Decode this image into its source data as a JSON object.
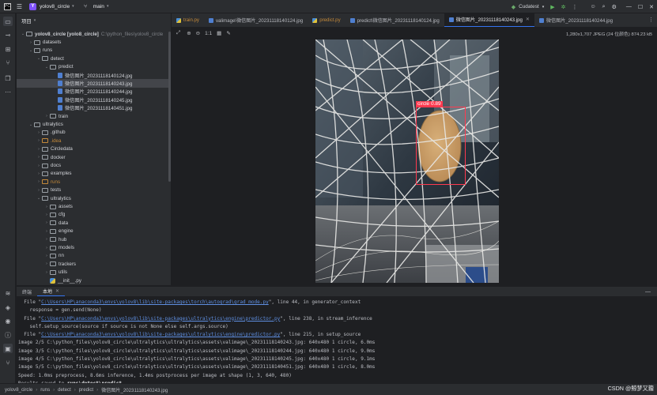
{
  "titlebar": {
    "project_badge": "Y",
    "project_name": "yolov8_circle",
    "branch": "main",
    "run_config": "Cudatest"
  },
  "project_panel": {
    "title": "项目",
    "items": [
      {
        "label": "yolov8_circle [yolo8_circle]",
        "extra": "C:\\python_files\\yolov8_circle",
        "type": "folder",
        "indent": 0,
        "open": true,
        "bold": true
      },
      {
        "label": "datasets",
        "type": "folder",
        "indent": 1,
        "open": false
      },
      {
        "label": "runs",
        "type": "folder",
        "indent": 1,
        "open": true
      },
      {
        "label": "detect",
        "type": "folder",
        "indent": 2,
        "open": true
      },
      {
        "label": "predict",
        "type": "folder",
        "indent": 3,
        "open": true
      },
      {
        "label": "微信图片_20231118140124.jpg",
        "type": "image",
        "indent": 4
      },
      {
        "label": "微信图片_20231118140243.jpg",
        "type": "image",
        "indent": 4,
        "selected": true
      },
      {
        "label": "微信图片_20231118140244.jpg",
        "type": "image",
        "indent": 4
      },
      {
        "label": "微信图片_20231118140245.jpg",
        "type": "image",
        "indent": 4
      },
      {
        "label": "微信图片_20231118140451.jpg",
        "type": "image",
        "indent": 4
      },
      {
        "label": "train",
        "type": "folder",
        "indent": 3,
        "open": false
      },
      {
        "label": "ultralytics",
        "type": "folder",
        "indent": 1,
        "open": true
      },
      {
        "label": ".github",
        "type": "folder",
        "indent": 2,
        "open": false
      },
      {
        "label": ".idea",
        "type": "folder",
        "indent": 2,
        "open": false,
        "orange": true
      },
      {
        "label": "Circledata",
        "type": "folder",
        "indent": 2,
        "open": false
      },
      {
        "label": "docker",
        "type": "folder",
        "indent": 2,
        "open": false
      },
      {
        "label": "docs",
        "type": "folder",
        "indent": 2,
        "open": false
      },
      {
        "label": "examples",
        "type": "folder",
        "indent": 2,
        "open": false
      },
      {
        "label": "runs",
        "type": "folder",
        "indent": 2,
        "open": false,
        "orange": true
      },
      {
        "label": "tests",
        "type": "folder",
        "indent": 2,
        "open": false
      },
      {
        "label": "ultralytics",
        "type": "folder",
        "indent": 2,
        "open": true
      },
      {
        "label": "assets",
        "type": "folder",
        "indent": 3,
        "open": false
      },
      {
        "label": "cfg",
        "type": "folder",
        "indent": 3,
        "open": false
      },
      {
        "label": "data",
        "type": "folder",
        "indent": 3,
        "open": false
      },
      {
        "label": "engine",
        "type": "folder",
        "indent": 3,
        "open": false
      },
      {
        "label": "hub",
        "type": "folder",
        "indent": 3,
        "open": false
      },
      {
        "label": "models",
        "type": "folder",
        "indent": 3,
        "open": false
      },
      {
        "label": "nn",
        "type": "folder",
        "indent": 3,
        "open": false
      },
      {
        "label": "trackers",
        "type": "folder",
        "indent": 3,
        "open": false
      },
      {
        "label": "utils",
        "type": "folder",
        "indent": 3,
        "open": false
      },
      {
        "label": "__init__.py",
        "type": "python",
        "indent": 3
      }
    ]
  },
  "editor_tabs": [
    {
      "label": "train.py",
      "kind": "py",
      "orange": true
    },
    {
      "label": "valimage\\微信图片_20231118140124.jpg",
      "kind": "img"
    },
    {
      "label": "predict.py",
      "kind": "py",
      "orange": true
    },
    {
      "label": "predict\\微信图片_20231118140124.jpg",
      "kind": "img"
    },
    {
      "label": "微信图片_20231118140243.jpg",
      "kind": "img",
      "active": true
    },
    {
      "label": "微信图片_20231118140244.jpg",
      "kind": "img"
    }
  ],
  "image_info": "1,280x1,707 JPEG (24 位颜色) 874.23 kB",
  "image_toolbar": {
    "zoom_label": "1:1"
  },
  "detection": {
    "label": "circle  0.89",
    "color": "#ff3a4f"
  },
  "terminal": {
    "tabs": [
      {
        "label": "终端",
        "active": false
      },
      {
        "label": "本地",
        "active": true
      }
    ],
    "lines": [
      {
        "pre": "  File \"",
        "link": "C:\\Users\\HP\\anaconda3\\envs\\yolov8\\lib\\site-packages\\torch\\autograd\\grad_mode.py",
        "post": "\", line 44, in generator_context"
      },
      {
        "pre": "    response = gen.send(None)",
        "link": "",
        "post": ""
      },
      {
        "pre": "  File \"",
        "link": "C:\\Users\\HP\\anaconda3\\envs\\yolov8\\lib\\site-packages\\ultralytics\\engine\\predictor.py",
        "post": "\", line 238, in stream_inference"
      },
      {
        "pre": "    self.setup_source(source if source is not None else self.args.source)",
        "link": "",
        "post": ""
      },
      {
        "pre": "  File \"",
        "link": "C:\\Users\\HP\\anaconda3\\envs\\yolov8\\lib\\site-packages\\ultralytics\\engine\\predictor.py",
        "post": "\", line 215, in setup_source"
      },
      {
        "pre": "image 2/5 C:\\python_files\\yolov8_circle\\ultralytics\\ultralytics\\assets\\valimage\\_20231118140243.jpg: 640x480 1 circle, 6.0ms",
        "link": "",
        "post": ""
      },
      {
        "pre": "image 3/5 C:\\python_files\\yolov8_circle\\ultralytics\\ultralytics\\assets\\valimage\\_20231118140244.jpg: 640x480 1 circle, 9.0ms",
        "link": "",
        "post": ""
      },
      {
        "pre": "image 4/5 C:\\python_files\\yolov8_circle\\ultralytics\\ultralytics\\assets\\valimage\\_20231118140245.jpg: 640x480 1 circle, 9.1ms",
        "link": "",
        "post": ""
      },
      {
        "pre": "image 5/5 C:\\python_files\\yolov8_circle\\ultralytics\\ultralytics\\assets\\valimage\\_20231118140451.jpg: 640x480 1 circle, 8.0ms",
        "link": "",
        "post": ""
      },
      {
        "pre": "Speed: 1.0ms preprocess, 8.6ms inference, 1.4ms postprocess per image at shape (1, 3, 640, 480)",
        "link": "",
        "post": ""
      },
      {
        "pre": "Results saved to ",
        "link": "",
        "post": "",
        "bold": "runs\\detect\\predict"
      }
    ]
  },
  "statusbar": {
    "crumbs": [
      "yolov8_circle",
      "runs",
      "detect",
      "predict",
      "微信图片_20231118140243.jpg"
    ]
  },
  "watermark": "CSDN @鲸梦又籀"
}
